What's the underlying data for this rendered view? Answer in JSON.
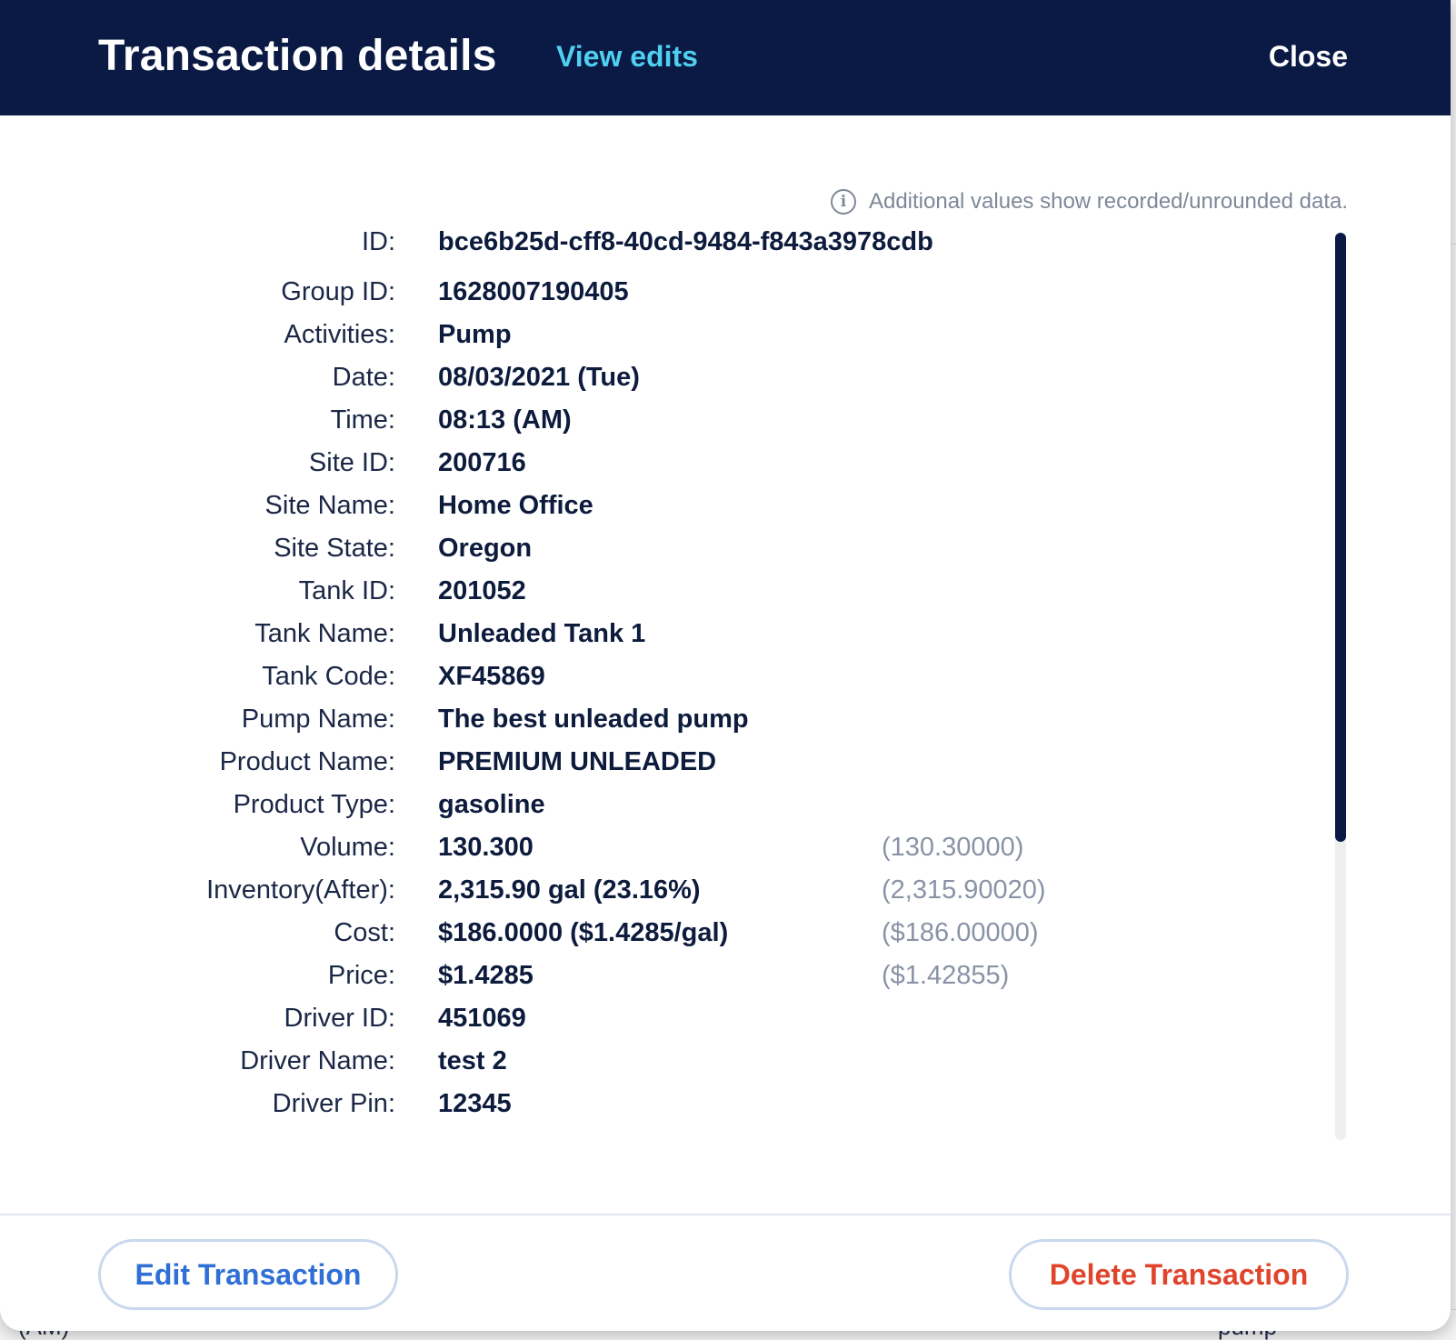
{
  "header": {
    "title": "Transaction details",
    "view_edits_label": "View edits",
    "close_label": "Close"
  },
  "info_note": "Additional values show recorded/unrounded data.",
  "fields": [
    {
      "label": "ID:",
      "value": "bce6b25d-cff8-40cd-9484-f843a3978cdb",
      "raw": ""
    },
    {
      "label": "Group ID:",
      "value": "1628007190405",
      "raw": ""
    },
    {
      "label": "Activities:",
      "value": "Pump",
      "raw": ""
    },
    {
      "label": "Date:",
      "value": "08/03/2021 (Tue)",
      "raw": ""
    },
    {
      "label": "Time:",
      "value": "08:13 (AM)",
      "raw": ""
    },
    {
      "label": "Site ID:",
      "value": "200716",
      "raw": ""
    },
    {
      "label": "Site Name:",
      "value": "Home Office",
      "raw": ""
    },
    {
      "label": "Site State:",
      "value": "Oregon",
      "raw": ""
    },
    {
      "label": "Tank ID:",
      "value": "201052",
      "raw": ""
    },
    {
      "label": "Tank Name:",
      "value": "Unleaded Tank 1",
      "raw": ""
    },
    {
      "label": "Tank Code:",
      "value": "XF45869",
      "raw": ""
    },
    {
      "label": "Pump Name:",
      "value": "The best unleaded pump",
      "raw": ""
    },
    {
      "label": "Product Name:",
      "value": "PREMIUM UNLEADED",
      "raw": ""
    },
    {
      "label": "Product Type:",
      "value": "gasoline",
      "raw": ""
    },
    {
      "label": "Volume:",
      "value": "130.300",
      "raw": "(130.30000)"
    },
    {
      "label": "Inventory(After):",
      "value": "2,315.90 gal (23.16%)",
      "raw": "(2,315.90020)"
    },
    {
      "label": "Cost:",
      "value": "$186.0000 ($1.4285/gal)",
      "raw": "($186.00000)"
    },
    {
      "label": "Price:",
      "value": "$1.4285",
      "raw": "($1.42855)"
    },
    {
      "label": "Driver ID:",
      "value": "451069",
      "raw": ""
    },
    {
      "label": "Driver Name:",
      "value": "test 2",
      "raw": ""
    },
    {
      "label": "Driver Pin:",
      "value": "12345",
      "raw": ""
    }
  ],
  "footer": {
    "edit_label": "Edit Transaction",
    "delete_label": "Delete Transaction"
  },
  "background": {
    "peek_left": "(AM)",
    "peek_right": "pump"
  },
  "colors": {
    "header_bg": "#0b1a45",
    "link": "#4fd0f0",
    "edit": "#2f6fd6",
    "delete": "#e0452c"
  }
}
